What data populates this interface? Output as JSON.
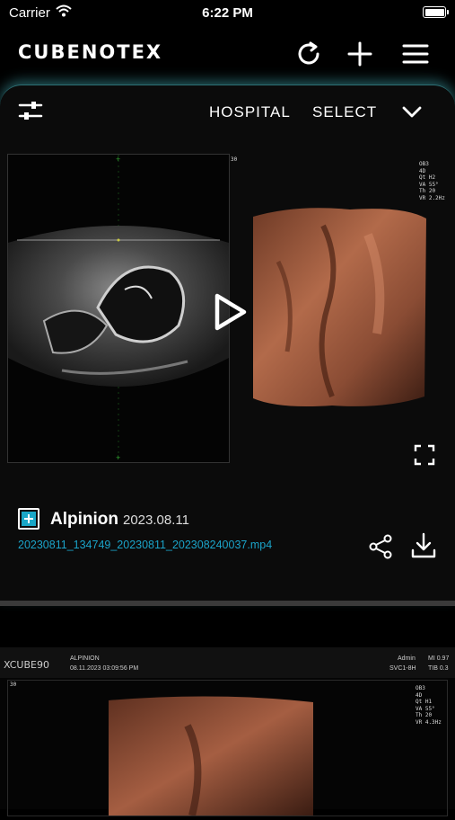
{
  "status_bar": {
    "carrier": "Carrier",
    "time": "6:22 PM"
  },
  "app_bar": {
    "logo": "CUBENOTEX",
    "icons": [
      "refresh-icon",
      "add-icon",
      "menu-icon"
    ]
  },
  "toolbar": {
    "filter_icon": "sliders-icon",
    "hospital_label": "HOSPITAL",
    "select_label": "SELECT",
    "chevron_icon": "chevron-down-icon"
  },
  "video_card": {
    "overlay_text": [
      "OB3",
      "4D",
      "Qt H2",
      "VA 55°",
      "Th 20",
      "VR 2.2Hz"
    ],
    "frame_number": "30",
    "patient_name": "Alpinion",
    "date": "2023.08.11",
    "file_name": "20230811_134749_20230811_202308240037.mp4",
    "actions": [
      "play-icon",
      "fullscreen-icon",
      "share-icon",
      "download-icon"
    ]
  },
  "second_card": {
    "logo": "XCUBE90",
    "brand": "ALPINION",
    "datetime": "08.11.2023    03:09:56 PM",
    "user": "Admin",
    "probe": "SVC1-8H",
    "mi": "MI 0.97",
    "tib": "TIB 0.3",
    "frame_number": "30",
    "overlay_text": [
      "OB3",
      "4D",
      "Qt H1",
      "VA 55°",
      "Th 20",
      "VR 4.3Hz"
    ]
  }
}
